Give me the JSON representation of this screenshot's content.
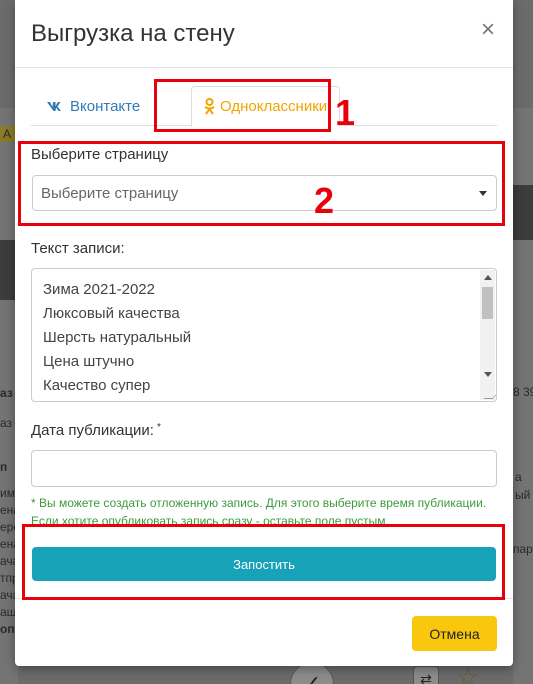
{
  "modal": {
    "title": "Выгрузка на стену",
    "close_glyph": "×"
  },
  "tabs": [
    {
      "label": "Вконтакте",
      "icon": "vk-icon",
      "active": false
    },
    {
      "label": "Одноклассники",
      "icon": "odnoklassniki-icon",
      "active": true
    }
  ],
  "page_select": {
    "label": "Выберите страницу",
    "selected": "Выберите страницу"
  },
  "post_text": {
    "label": "Текст записи:",
    "lines": [
      "Зима 2021-2022",
      "Люксовый качества",
      "Шерсть натуральный",
      "Цена штучно",
      "Качество супер"
    ]
  },
  "publish_date": {
    "label": "Дата публикации:",
    "required_mark": "*",
    "value": "",
    "hint": "* Вы можете создать отложенную запись. Для этого выберите время публикации. Если хотите опубликовать запись сразу - оставьте поле пустым."
  },
  "buttons": {
    "post": "Запостить",
    "cancel": "Отмена"
  },
  "annotations": {
    "one": "1",
    "two": "2"
  },
  "background": {
    "badge": "А С",
    "fragments": [
      "аз",
      "аз",
      "п",
      "има",
      "ена",
      "ерс",
      "ена",
      "ача",
      "тпр",
      "ача",
      "аш",
      "#о",
      "оп"
    ],
    "price": "8 39",
    "right_fragments": [
      "а",
      "ый",
      "пара"
    ]
  },
  "colors": {
    "tab_active": "#f4a300",
    "tab_link": "#337ab7",
    "post_button": "#17a2b8",
    "cancel_button": "#f9c80e",
    "hint_text": "#3c9b3c",
    "annotation": "#e8000b"
  }
}
